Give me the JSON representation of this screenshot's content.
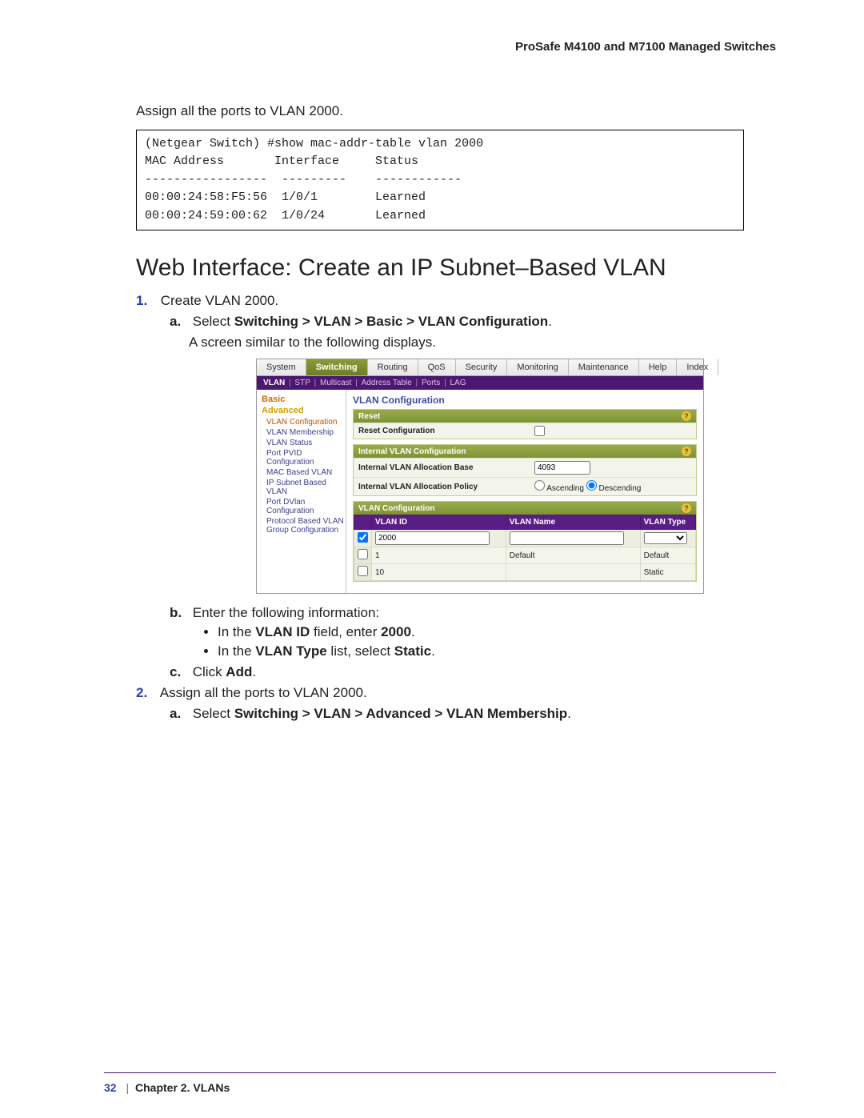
{
  "doc_header": "ProSafe M4100 and M7100 Managed Switches",
  "intro_line": "Assign all the ports to VLAN 2000.",
  "code_block": "(Netgear Switch) #show mac-addr-table vlan 2000\nMAC Address       Interface     Status\n-----------------  ---------    ------------\n00:00:24:58:F5:56  1/0/1        Learned\n00:00:24:59:00:62  1/0/24       Learned",
  "section_title": "Web Interface: Create an IP Subnet–Based VLAN",
  "step1_num": "1.",
  "step1_text": "Create VLAN 2000.",
  "step1a_marker": "a.",
  "step1a_pre": "Select ",
  "step1a_bold": "Switching > VLAN > Basic > VLAN Configuration",
  "step1a_post": ".",
  "step1a_note": "A screen similar to the following displays.",
  "step1b_marker": "b.",
  "step1b_text": "Enter the following information:",
  "bullet1_pre": "In the ",
  "bullet1_bold": "VLAN ID",
  "bullet1_mid": " field, enter ",
  "bullet1_suf": "2000",
  "bullet1_post": ".",
  "bullet2_pre": "In the ",
  "bullet2_bold": "VLAN Type",
  "bullet2_mid": " list, select ",
  "bullet2_suf": "Static",
  "bullet2_post": ".",
  "step1c_marker": "c.",
  "step1c_pre": "Click ",
  "step1c_bold": "Add",
  "step1c_post": ".",
  "step2_num": "2.",
  "step2_text": "Assign all the ports to VLAN 2000.",
  "step2a_marker": "a.",
  "step2a_pre": "Select ",
  "step2a_bold": "Switching > VLAN > Advanced > VLAN Membership",
  "step2a_post": ".",
  "footer_page": "32",
  "footer_sep": "|",
  "footer_text": "Chapter 2.  VLANs",
  "ui": {
    "tabs": [
      "System",
      "Switching",
      "Routing",
      "QoS",
      "Security",
      "Monitoring",
      "Maintenance",
      "Help",
      "Index"
    ],
    "active_tab_index": 1,
    "subnav": [
      "VLAN",
      "STP",
      "Multicast",
      "Address Table",
      "Ports",
      "LAG"
    ],
    "subnav_sel_index": 0,
    "side_basic": "Basic",
    "side_adv": "Advanced",
    "side_links": [
      "VLAN Configuration",
      "VLAN Membership",
      "VLAN Status",
      "Port PVID Configuration",
      "MAC Based VLAN",
      "IP Subnet Based VLAN",
      "Port DVlan Configuration",
      "Protocol Based VLAN Group Configuration"
    ],
    "side_sel_index": 0,
    "main_title": "VLAN Configuration",
    "panel_reset_title": "Reset",
    "panel_reset_lbl": "Reset Configuration",
    "panel_internal_title": "Internal VLAN Configuration",
    "int_row1_lbl": "Internal VLAN Allocation Base",
    "int_row1_val": "4093",
    "int_row2_lbl": "Internal VLAN Allocation Policy",
    "int_row2_opt1": "Ascending",
    "int_row2_opt2": "Descending",
    "panel_vlan_title": "VLAN Configuration",
    "tbl_h1": "VLAN ID",
    "tbl_h2": "VLAN Name",
    "tbl_h3": "VLAN Type",
    "tbl_input_id": "2000",
    "tbl_r1_id": "1",
    "tbl_r1_name": "Default",
    "tbl_r1_type": "Default",
    "tbl_r2_id": "10",
    "tbl_r2_name": "",
    "tbl_r2_type": "Static",
    "help_q": "?"
  }
}
